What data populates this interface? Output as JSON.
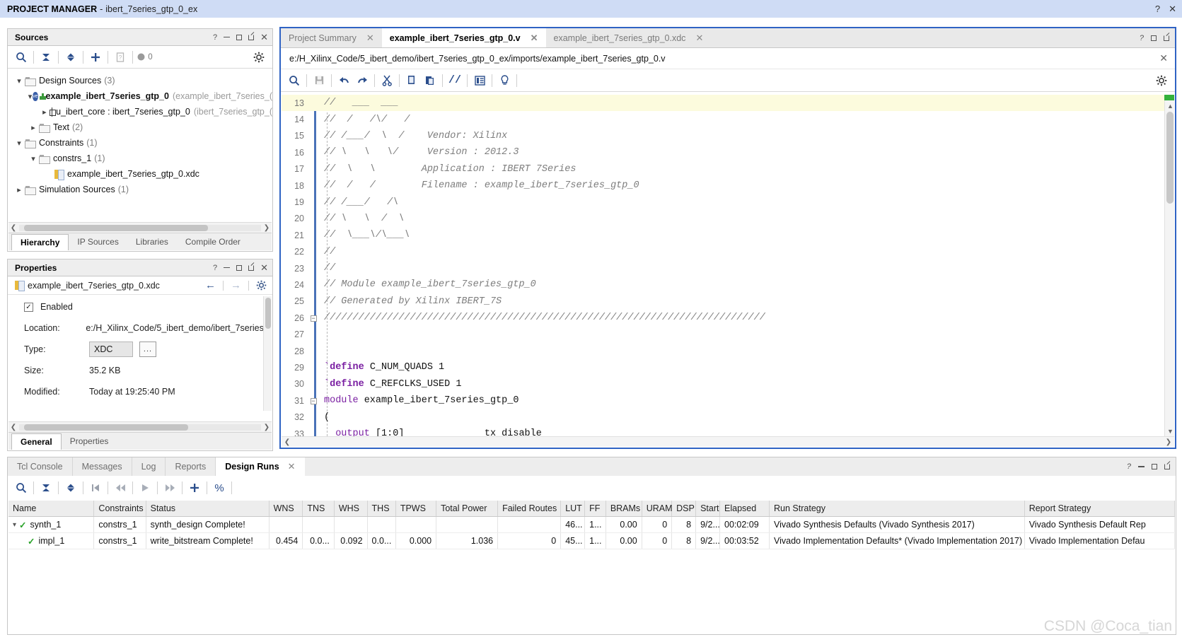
{
  "banner": {
    "title": "PROJECT MANAGER",
    "separator": "-",
    "project": "ibert_7series_gtp_0_ex",
    "help_icon": "?",
    "close_icon": "✕"
  },
  "sources_panel": {
    "title": "Sources",
    "window_buttons": [
      "?",
      "minimize",
      "maximize",
      "float",
      "close"
    ],
    "toolbar": [
      {
        "name": "search-icon",
        "label": "search"
      },
      {
        "name": "collapse-all-icon",
        "label": "collapse all"
      },
      {
        "name": "expand-all-icon",
        "label": "expand all"
      },
      {
        "name": "add-sources-icon",
        "label": "add sources"
      },
      {
        "name": "report-icon",
        "label": "report"
      },
      {
        "name": "messages-icon",
        "label": "messages"
      },
      {
        "name": "gear-icon",
        "label": "settings"
      }
    ],
    "message_count": "0",
    "tree": [
      {
        "indent": 0,
        "twisty": "open",
        "icon": "folder",
        "label": "Design Sources",
        "count": "(3)",
        "bold": false,
        "muted": ""
      },
      {
        "indent": 1,
        "twisty": "open",
        "icon": "verilog",
        "label": "example_ibert_7series_gtp_0",
        "count": "",
        "bold": true,
        "muted": "(example_ibert_7series_("
      },
      {
        "indent": 2,
        "twisty": "closed",
        "icon": "chip",
        "label": "u_ibert_core : ibert_7series_gtp_0",
        "count": "",
        "bold": false,
        "muted": "(ibert_7series_gtp_("
      },
      {
        "indent": 1,
        "twisty": "closed",
        "icon": "folder",
        "label": "Text",
        "count": "(2)",
        "bold": false,
        "muted": ""
      },
      {
        "indent": 0,
        "twisty": "open",
        "icon": "folder",
        "label": "Constraints",
        "count": "(1)",
        "bold": false,
        "muted": ""
      },
      {
        "indent": 1,
        "twisty": "open",
        "icon": "folder",
        "label": "constrs_1",
        "count": "(1)",
        "bold": false,
        "muted": ""
      },
      {
        "indent": 2,
        "twisty": "none",
        "icon": "xdc",
        "label": "example_ibert_7series_gtp_0.xdc",
        "count": "",
        "bold": false,
        "muted": ""
      },
      {
        "indent": 0,
        "twisty": "closed",
        "icon": "folder",
        "label": "Simulation Sources",
        "count": "(1)",
        "bold": false,
        "muted": ""
      }
    ],
    "tabs": [
      {
        "label": "Hierarchy",
        "active": true
      },
      {
        "label": "IP Sources",
        "active": false
      },
      {
        "label": "Libraries",
        "active": false
      },
      {
        "label": "Compile Order",
        "active": false
      }
    ]
  },
  "properties_panel": {
    "title": "Properties",
    "file_name": "example_ibert_7series_gtp_0.xdc",
    "nav_back_icon": "←",
    "nav_fwd_icon": "→",
    "gear_icon": "gear",
    "enabled_label": "Enabled",
    "enabled_checked": true,
    "rows": [
      {
        "label": "Location:",
        "value": "e:/H_Xilinx_Code/5_ibert_demo/ibert_7series_("
      },
      {
        "label": "Type:",
        "value": "XDC",
        "kind": "select",
        "browse": "..."
      },
      {
        "label": "Size:",
        "value": "35.2 KB"
      },
      {
        "label": "Modified:",
        "value": "Today at 19:25:40 PM"
      }
    ],
    "tabs": [
      {
        "label": "General",
        "active": true
      },
      {
        "label": "Properties",
        "active": false
      }
    ]
  },
  "editor": {
    "tabs": [
      {
        "label": "Project Summary",
        "active": false,
        "closable": true
      },
      {
        "label": "example_ibert_7series_gtp_0.v",
        "active": true,
        "closable": true
      },
      {
        "label": "example_ibert_7series_gtp_0.xdc",
        "active": false,
        "closable": true
      }
    ],
    "window_buttons": [
      "?",
      "minimize",
      "maximize",
      "float"
    ],
    "file_path": "e:/H_Xilinx_Code/5_ibert_demo/ibert_7series_gtp_0_ex/imports/example_ibert_7series_gtp_0.v",
    "path_close_icon": "✕",
    "toolbar": [
      {
        "name": "find-icon",
        "label": "find"
      },
      {
        "name": "save-icon",
        "label": "save"
      },
      {
        "name": "undo-icon",
        "label": "undo"
      },
      {
        "name": "redo-icon",
        "label": "redo"
      },
      {
        "name": "cut-icon",
        "label": "cut"
      },
      {
        "name": "copy-icon",
        "label": "copy"
      },
      {
        "name": "paste-icon",
        "label": "paste"
      },
      {
        "name": "comment-icon",
        "label": "toggle comment"
      },
      {
        "name": "indent-icon",
        "label": "auto indent"
      },
      {
        "name": "bulb-icon",
        "label": "hints"
      },
      {
        "name": "gear-icon",
        "label": "editor settings"
      }
    ],
    "first_line": 13,
    "highlight_line": 13,
    "code": [
      {
        "n": 13,
        "fold": "",
        "tokens": [
          {
            "c": "cm",
            "t": "//   ___  ___"
          }
        ]
      },
      {
        "n": 14,
        "fold": "",
        "tokens": [
          {
            "c": "cm",
            "t": "//  /   /\\/   /"
          }
        ]
      },
      {
        "n": 15,
        "fold": "",
        "tokens": [
          {
            "c": "cm",
            "t": "// /___/  \\  /    Vendor: Xilinx"
          }
        ]
      },
      {
        "n": 16,
        "fold": "",
        "tokens": [
          {
            "c": "cm",
            "t": "// \\   \\   \\/     Version : 2012.3"
          }
        ]
      },
      {
        "n": 17,
        "fold": "",
        "tokens": [
          {
            "c": "cm",
            "t": "//  \\   \\        Application : IBERT 7Series"
          }
        ]
      },
      {
        "n": 18,
        "fold": "",
        "tokens": [
          {
            "c": "cm",
            "t": "//  /   /        Filename : example_ibert_7series_gtp_0"
          }
        ]
      },
      {
        "n": 19,
        "fold": "",
        "tokens": [
          {
            "c": "cm",
            "t": "// /___/   /\\"
          }
        ]
      },
      {
        "n": 20,
        "fold": "",
        "tokens": [
          {
            "c": "cm",
            "t": "// \\   \\  /  \\"
          }
        ]
      },
      {
        "n": 21,
        "fold": "",
        "tokens": [
          {
            "c": "cm",
            "t": "//  \\___\\/\\___\\"
          }
        ]
      },
      {
        "n": 22,
        "fold": "",
        "tokens": [
          {
            "c": "cm",
            "t": "//"
          }
        ]
      },
      {
        "n": 23,
        "fold": "",
        "tokens": [
          {
            "c": "cm",
            "t": "//"
          }
        ]
      },
      {
        "n": 24,
        "fold": "",
        "tokens": [
          {
            "c": "cm",
            "t": "// Module example_ibert_7series_gtp_0"
          }
        ]
      },
      {
        "n": 25,
        "fold": "",
        "tokens": [
          {
            "c": "cm",
            "t": "// Generated by Xilinx IBERT_7S"
          }
        ]
      },
      {
        "n": 26,
        "fold": "minus",
        "tokens": [
          {
            "c": "cm",
            "t": "/////////////////////////////////////////////////////////////////////////////"
          }
        ]
      },
      {
        "n": 27,
        "fold": "",
        "tokens": [
          {
            "c": "pl",
            "t": ""
          }
        ]
      },
      {
        "n": 28,
        "fold": "",
        "tokens": [
          {
            "c": "pl",
            "t": ""
          }
        ]
      },
      {
        "n": 29,
        "fold": "",
        "tokens": [
          {
            "c": "kw",
            "t": "`define"
          },
          {
            "c": "pl",
            "t": " C_NUM_QUADS 1"
          }
        ]
      },
      {
        "n": 30,
        "fold": "",
        "tokens": [
          {
            "c": "kw",
            "t": "`define"
          },
          {
            "c": "pl",
            "t": " C_REFCLKS_USED 1"
          }
        ]
      },
      {
        "n": 31,
        "fold": "minus",
        "tokens": [
          {
            "c": "kw2",
            "t": "module"
          },
          {
            "c": "pl",
            "t": " example_ibert_7series_gtp_0"
          }
        ]
      },
      {
        "n": 32,
        "fold": "",
        "tokens": [
          {
            "c": "pl",
            "t": "("
          }
        ]
      },
      {
        "n": 33,
        "fold": "",
        "tokens": [
          {
            "c": "kw2",
            "t": "  output"
          },
          {
            "c": "pl",
            "t": " [1:0]              tx_disable"
          }
        ]
      }
    ]
  },
  "console": {
    "tabs": [
      {
        "label": "Tcl Console",
        "active": false
      },
      {
        "label": "Messages",
        "active": false
      },
      {
        "label": "Log",
        "active": false
      },
      {
        "label": "Reports",
        "active": false
      },
      {
        "label": "Design Runs",
        "active": true,
        "closable": true
      }
    ],
    "window_buttons": [
      "?",
      "minimize",
      "maximize",
      "float"
    ],
    "toolbar": [
      {
        "name": "search-icon",
        "label": "search"
      },
      {
        "name": "collapse-all-icon",
        "label": "collapse all"
      },
      {
        "name": "expand-all-icon",
        "label": "expand all"
      },
      {
        "name": "reset-run-icon",
        "label": "reset run"
      },
      {
        "name": "rewind-icon",
        "label": "previous"
      },
      {
        "name": "launch-runs-icon",
        "label": "launch runs"
      },
      {
        "name": "forward-icon",
        "label": "next"
      },
      {
        "name": "create-runs-icon",
        "label": "create runs"
      },
      {
        "name": "percent-icon",
        "label": "progress"
      }
    ],
    "columns": [
      "Name",
      "Constraints",
      "Status",
      "WNS",
      "TNS",
      "WHS",
      "THS",
      "TPWS",
      "Total Power",
      "Failed Routes",
      "LUT",
      "FF",
      "BRAMs",
      "URAM",
      "DSP",
      "Start",
      "Elapsed",
      "Run Strategy",
      "Report Strategy"
    ],
    "rows": [
      {
        "twisty": "open",
        "indent": false,
        "check": "✓",
        "name": "synth_1",
        "constraints": "constrs_1",
        "status": "synth_design Complete!",
        "wns": "",
        "tns": "",
        "whs": "",
        "ths": "",
        "tpws": "",
        "total_power": "",
        "failed_routes": "",
        "lut": "46...",
        "ff": "1...",
        "brams": "0.00",
        "uram": "0",
        "dsp": "8",
        "start": "9/2...",
        "elapsed": "00:02:09",
        "run_strategy": "Vivado Synthesis Defaults (Vivado Synthesis 2017)",
        "report_strategy": "Vivado Synthesis Default Rep"
      },
      {
        "twisty": "none",
        "indent": true,
        "check": "✓",
        "name": "impl_1",
        "constraints": "constrs_1",
        "status": "write_bitstream Complete!",
        "wns": "0.454",
        "tns": "0.0...",
        "whs": "0.092",
        "ths": "0.0...",
        "tpws": "0.000",
        "total_power": "1.036",
        "failed_routes": "0",
        "lut": "45...",
        "ff": "1...",
        "brams": "0.00",
        "uram": "0",
        "dsp": "8",
        "start": "9/2...",
        "elapsed": "00:03:52",
        "run_strategy": "Vivado Implementation Defaults* (Vivado Implementation 2017)",
        "report_strategy": "Vivado Implementation Defau"
      }
    ]
  },
  "watermark": "CSDN @Coca_tian"
}
